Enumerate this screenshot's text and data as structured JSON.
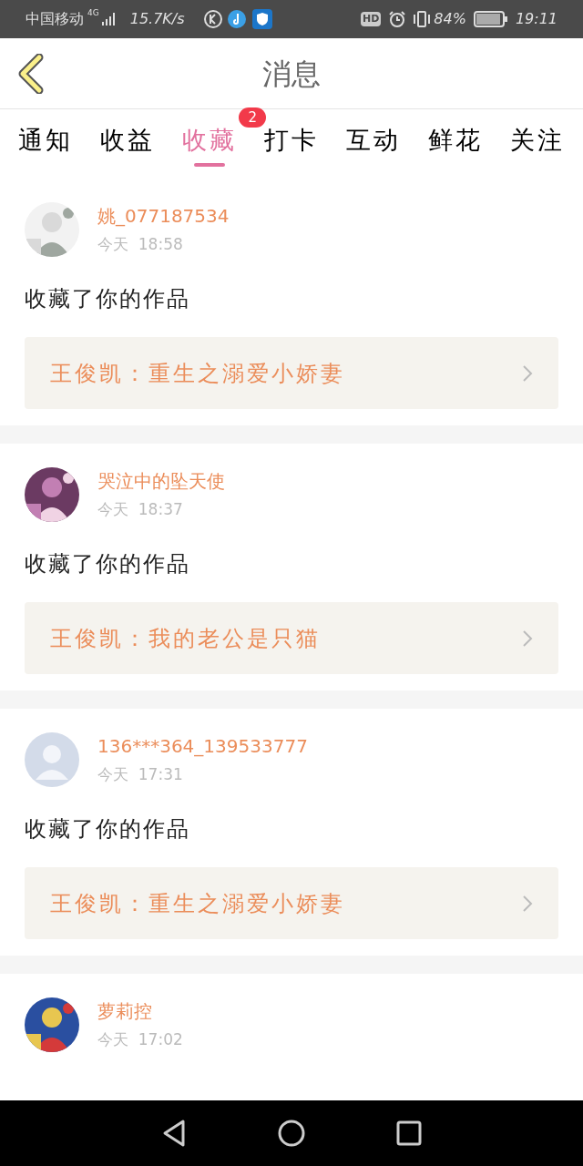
{
  "status_bar": {
    "carrier": "中国移动",
    "network": "4G",
    "speed": "15.7K/s",
    "hd": "HD",
    "battery": "84%",
    "time": "19:11"
  },
  "header": {
    "title": "消息"
  },
  "tabs": [
    {
      "label": "通知",
      "selected": false
    },
    {
      "label": "收益",
      "selected": false
    },
    {
      "label": "收藏",
      "selected": true,
      "badge": "2"
    },
    {
      "label": "打卡",
      "selected": false
    },
    {
      "label": "互动",
      "selected": false
    },
    {
      "label": "鲜花",
      "selected": false
    },
    {
      "label": "关注",
      "selected": false
    }
  ],
  "messages": [
    {
      "kind": "picture",
      "name": "姚_077187534",
      "time": "今天  18:58",
      "text": "收藏了你的作品",
      "work": "王俊凯：重生之溺爱小娇妻"
    },
    {
      "kind": "picture",
      "name": "哭泣中的坠天使",
      "time": "今天  18:37",
      "text": "收藏了你的作品",
      "work": "王俊凯：我的老公是只猫"
    },
    {
      "kind": "default",
      "name": "136***364_139533777",
      "time": "今天  17:31",
      "text": "收藏了你的作品",
      "work": "王俊凯：重生之溺爱小娇妻"
    },
    {
      "kind": "picture",
      "name": "萝莉控",
      "time": "今天  17:02"
    }
  ]
}
